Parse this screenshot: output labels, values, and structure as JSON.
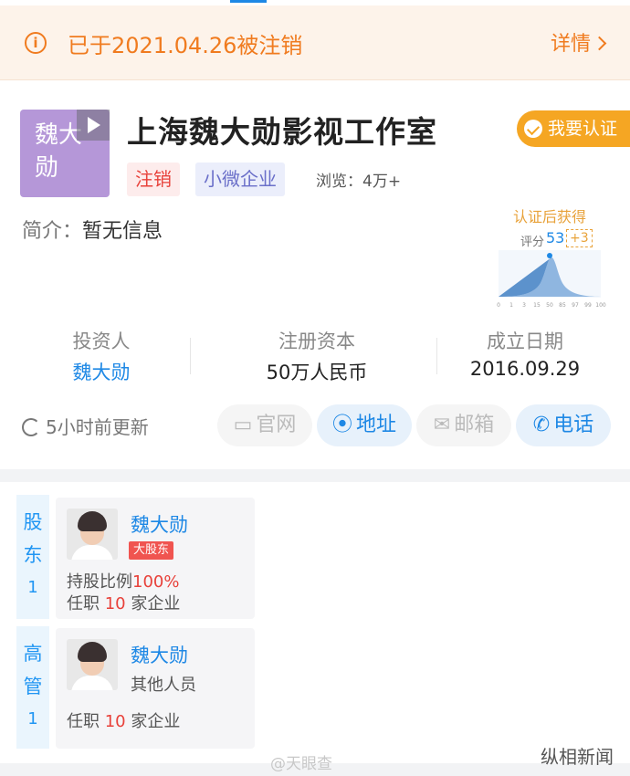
{
  "banner": {
    "message": "已于2021.04.26被注销",
    "detail_label": "详情"
  },
  "company": {
    "logo_text": "魏大勋",
    "name": "上海魏大勋影视工作室",
    "verify_label": "我要认证",
    "tags": [
      "注销",
      "小微企业"
    ],
    "views": "浏览：4万+",
    "intro_label": "简介：",
    "intro_value": "暂无信息"
  },
  "score": {
    "get_label": "认证后获得",
    "label": "评分",
    "value": "53",
    "plus": "+3",
    "axis": [
      "0",
      "1",
      "3",
      "15",
      "50",
      "85",
      "97",
      "99",
      "100"
    ]
  },
  "stats": [
    {
      "label": "投资人",
      "value": "魏大勋"
    },
    {
      "label": "注册资本",
      "value": "50万人民币"
    },
    {
      "label": "成立日期",
      "value": "2016.09.29"
    }
  ],
  "update_text": "5小时前更新",
  "actions": {
    "website": "官网",
    "address": "地址",
    "email": "邮箱",
    "phone": "电话"
  },
  "shareholders": {
    "side_label": "股东",
    "count": "1",
    "person": {
      "name": "魏大勋",
      "badge": "大股东",
      "share_prefix": "持股比例",
      "share_value": "100%",
      "jobs_prefix": "任职",
      "jobs_count": "10",
      "jobs_suffix": "家企业"
    }
  },
  "executives": {
    "side_label": "高管",
    "count": "1",
    "person": {
      "name": "魏大勋",
      "role": "其他人员",
      "jobs_prefix": "任职",
      "jobs_count": "10",
      "jobs_suffix": "家企业"
    }
  },
  "watermark": "@天眼查",
  "corner_mark": "纵相新闻",
  "colors": {
    "accent": "#1e88e5",
    "warning": "#f07b1f",
    "danger": "#e8413a",
    "gold": "#f5a623"
  }
}
